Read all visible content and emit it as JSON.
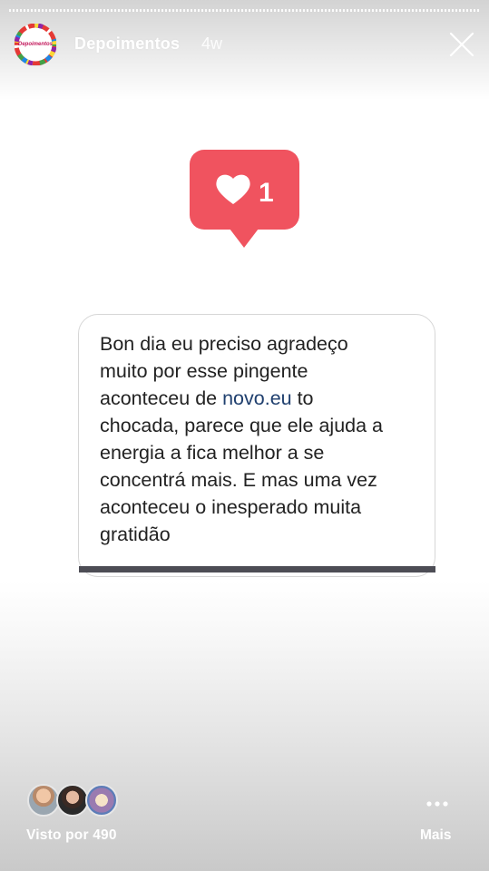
{
  "header": {
    "account_name": "Depoimentos",
    "time_ago": "4w",
    "avatar_text": "Depoimentos",
    "avatar_icon": "profile-logo-icon",
    "close_icon": "close-icon"
  },
  "notification": {
    "icon": "heart-icon",
    "count": "1",
    "color": "#f0535f"
  },
  "message": {
    "line1": "Bon dia eu preciso agradeço",
    "line2": "muito por esse pingente",
    "line3_before": "aconteceu de ",
    "line3_link": "novo.eu",
    "line3_after": " to",
    "line4": "chocada, parece que ele ajuda a",
    "line5": "energia a fica melhor a se",
    "line6": "concentrá mais. E mas uma vez",
    "line7": "aconteceu o inesperado muita",
    "line8": "gratidão"
  },
  "footer": {
    "viewers_label": "Visto por 490",
    "more_label": "Mais",
    "more_icon": "more-dots-icon",
    "viewer_avatars": [
      "viewer-avatar-1",
      "viewer-avatar-2",
      "viewer-avatar-3"
    ]
  }
}
